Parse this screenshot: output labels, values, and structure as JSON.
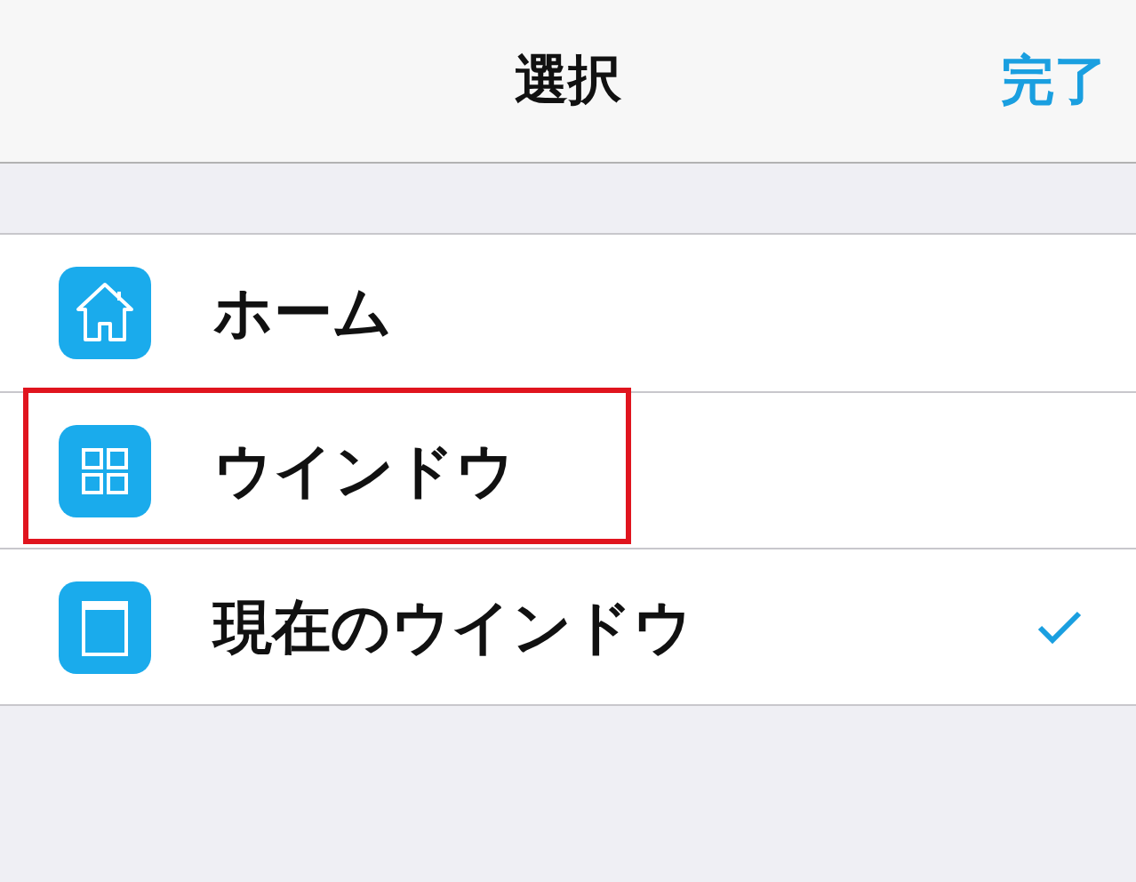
{
  "nav_bar": {
    "title": "選択",
    "done_button": "完了"
  },
  "items": [
    {
      "label": "ホーム",
      "kind": "home",
      "selected": false,
      "highlighted": false
    },
    {
      "label": "ウインドウ",
      "kind": "grid",
      "selected": false,
      "highlighted": true
    },
    {
      "label": "現在のウインドウ",
      "kind": "window",
      "selected": true,
      "highlighted": false
    }
  ]
}
